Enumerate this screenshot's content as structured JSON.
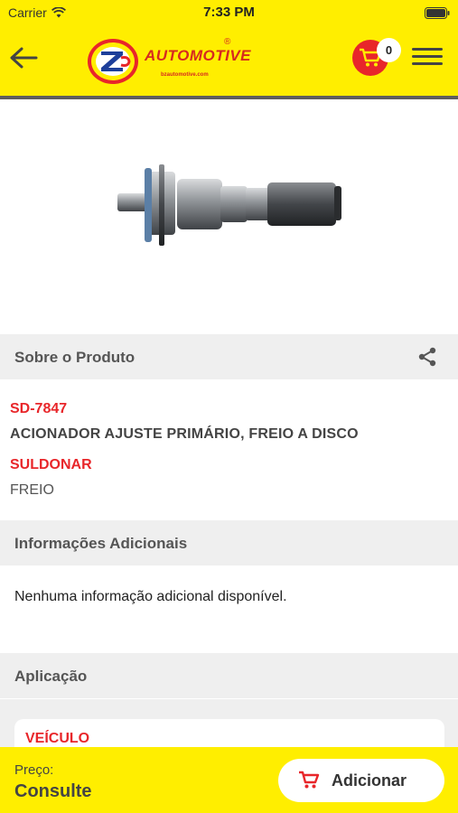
{
  "status_bar": {
    "carrier": "Carrier",
    "time": "7:33 PM"
  },
  "header": {
    "logo_wordmark": "AUTOMOTIVE",
    "logo_registered": "®",
    "logo_url": "bzautomotive.com",
    "cart_count": "0",
    "icons": {
      "back": "arrow-left-icon",
      "cart": "shopping-cart-icon",
      "menu": "hamburger-menu-icon"
    },
    "colors": {
      "bar": "#ffee00",
      "accent": "#e8262a"
    }
  },
  "sections": {
    "about": {
      "title": "Sobre o Produto",
      "share_icon": "share-icon"
    },
    "additional": {
      "title": "Informações Adicionais",
      "body": "Nenhuma informação adicional disponível."
    },
    "application": {
      "title": "Aplicação",
      "vehicle_label": "VEÍCULO"
    }
  },
  "product": {
    "code": "SD-7847",
    "name": "ACIONADOR AJUSTE PRIMÁRIO, FREIO A DISCO",
    "brand": "SULDONAR",
    "category": "FREIO"
  },
  "footer": {
    "price_label": "Preço:",
    "price_value": "Consulte",
    "add_button": "Adicionar"
  }
}
